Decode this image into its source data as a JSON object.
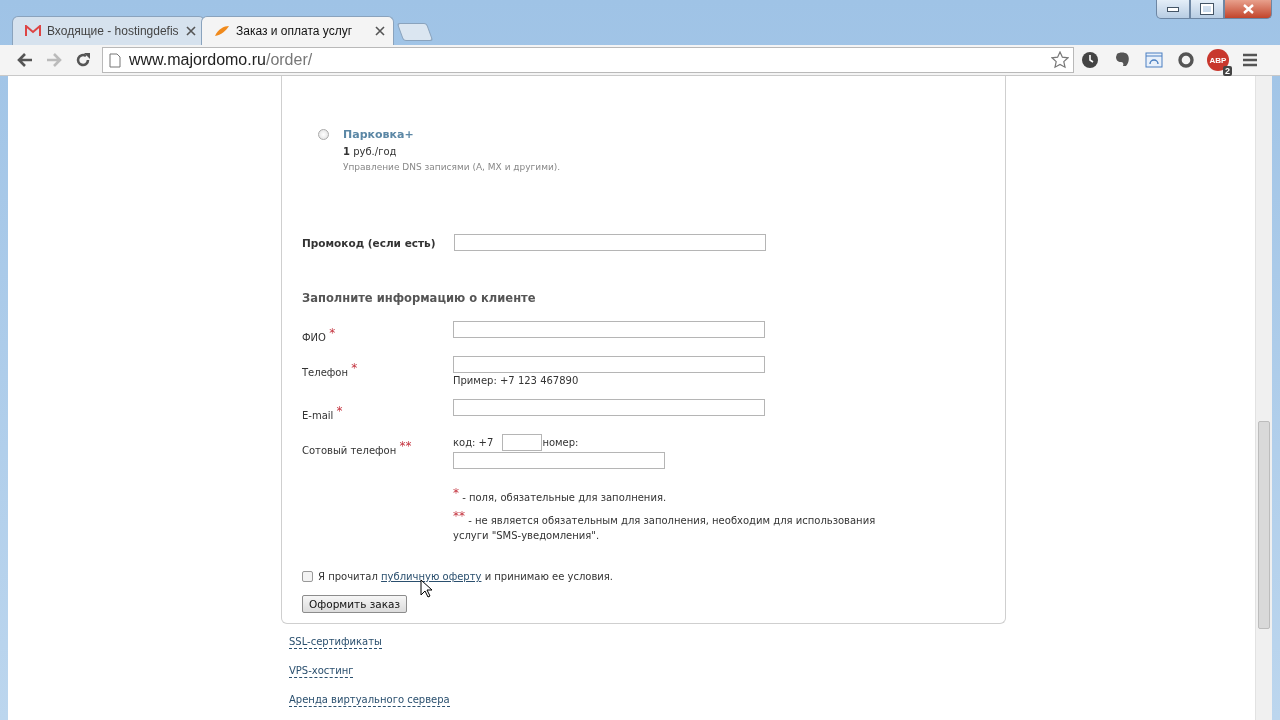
{
  "tabs": [
    {
      "title": "Входящие - hostingdefis",
      "kind": "mail",
      "selected": false
    },
    {
      "title": "Заказ и оплата услуг",
      "kind": "site",
      "selected": true
    }
  ],
  "address_bar": {
    "host": "www.majordomo.ru",
    "path": "/order/"
  },
  "adblock": {
    "label": "ABP",
    "badge": "2"
  },
  "options": [
    {
      "title": "Парковка+",
      "price": "1",
      "unit": "руб./год",
      "description": "Управление DNS записями (A, MX и другими).",
      "selected": false
    }
  ],
  "promo": {
    "label": "Промокод (если есть)"
  },
  "client_section": {
    "heading": "Заполните информацию о клиенте",
    "fields": [
      {
        "label": "ФИО",
        "required": "*",
        "kind": "text"
      },
      {
        "label": "Телефон",
        "required": "*",
        "kind": "text",
        "hint": "Пример: +7 123 467890"
      },
      {
        "label": "E-mail",
        "required": "*",
        "kind": "text"
      },
      {
        "label": "Сотовый телефон",
        "required": "**",
        "kind": "mobile",
        "code_label": "код: +7",
        "number_label": "номер:"
      }
    ],
    "notes": [
      {
        "mark": "*",
        "text": "- поля, обязательные для заполнения."
      },
      {
        "mark": "**",
        "text": "- не является обязательным для заполнения, необходим для использования услуги \"SMS-уведомления\"."
      }
    ]
  },
  "agreement": {
    "checked": false,
    "before": "Я прочитал",
    "link": "публичную оферту",
    "after": "и принимаю ее условия."
  },
  "submit": "Оформить заказ",
  "footer_links": [
    "SSL-сертификаты",
    "VPS-хостинг",
    "Аренда виртуального сервера"
  ]
}
